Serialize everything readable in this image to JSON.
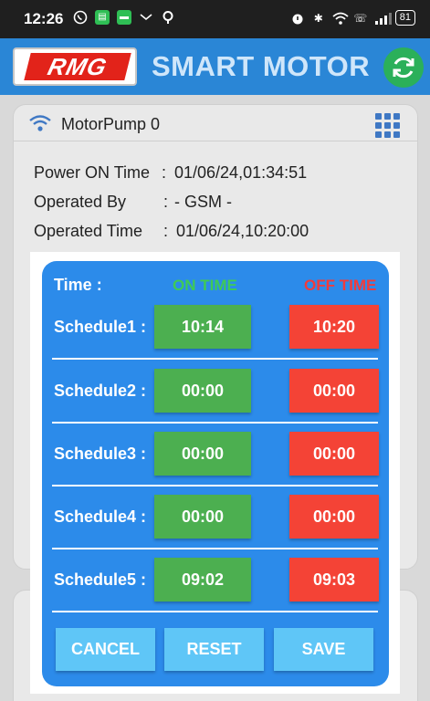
{
  "status_bar": {
    "time": "12:26",
    "battery": "81",
    "icons": [
      "whatsapp-icon",
      "app-icon",
      "messages-icon",
      "notification-icon",
      "location-icon",
      "alarm-icon",
      "bluetooth-icon",
      "wifi-icon",
      "volte-icon",
      "signal-icon",
      "battery-icon"
    ]
  },
  "header": {
    "logo_text": "RMG",
    "title": "SMART MOTOR",
    "refresh_icon": "refresh-icon",
    "colors": {
      "bar": "#2a86d6",
      "logo_red": "#e2231a",
      "refresh": "#2bb05a"
    }
  },
  "motor_card": {
    "name": "MotorPump 0",
    "rows": [
      {
        "label": "Power ON Time",
        "value": "01/06/24,01:34:51"
      },
      {
        "label": "Operated By",
        "value": "- GSM -"
      },
      {
        "label": "Operated Time",
        "value": "01/06/24,10:20:00"
      }
    ]
  },
  "schedule_dialog": {
    "time_label": "Time :",
    "on_header": "ON TIME",
    "off_header": "OFF TIME",
    "schedules": [
      {
        "label": "Schedule1 :",
        "on": "10:14",
        "off": "10:20"
      },
      {
        "label": "Schedule2 :",
        "on": "00:00",
        "off": "00:00"
      },
      {
        "label": "Schedule3 :",
        "on": "00:00",
        "off": "00:00"
      },
      {
        "label": "Schedule4 :",
        "on": "00:00",
        "off": "00:00"
      },
      {
        "label": "Schedule5 :",
        "on": "09:02",
        "off": "09:03"
      }
    ],
    "buttons": {
      "cancel": "CANCEL",
      "reset": "RESET",
      "save": "SAVE"
    },
    "colors": {
      "dialog": "#2c8bea",
      "on": "#4caf50",
      "off": "#f44336",
      "on_text": "#3fca56",
      "off_text": "#f23b3b",
      "action": "#5fc6f7"
    }
  }
}
